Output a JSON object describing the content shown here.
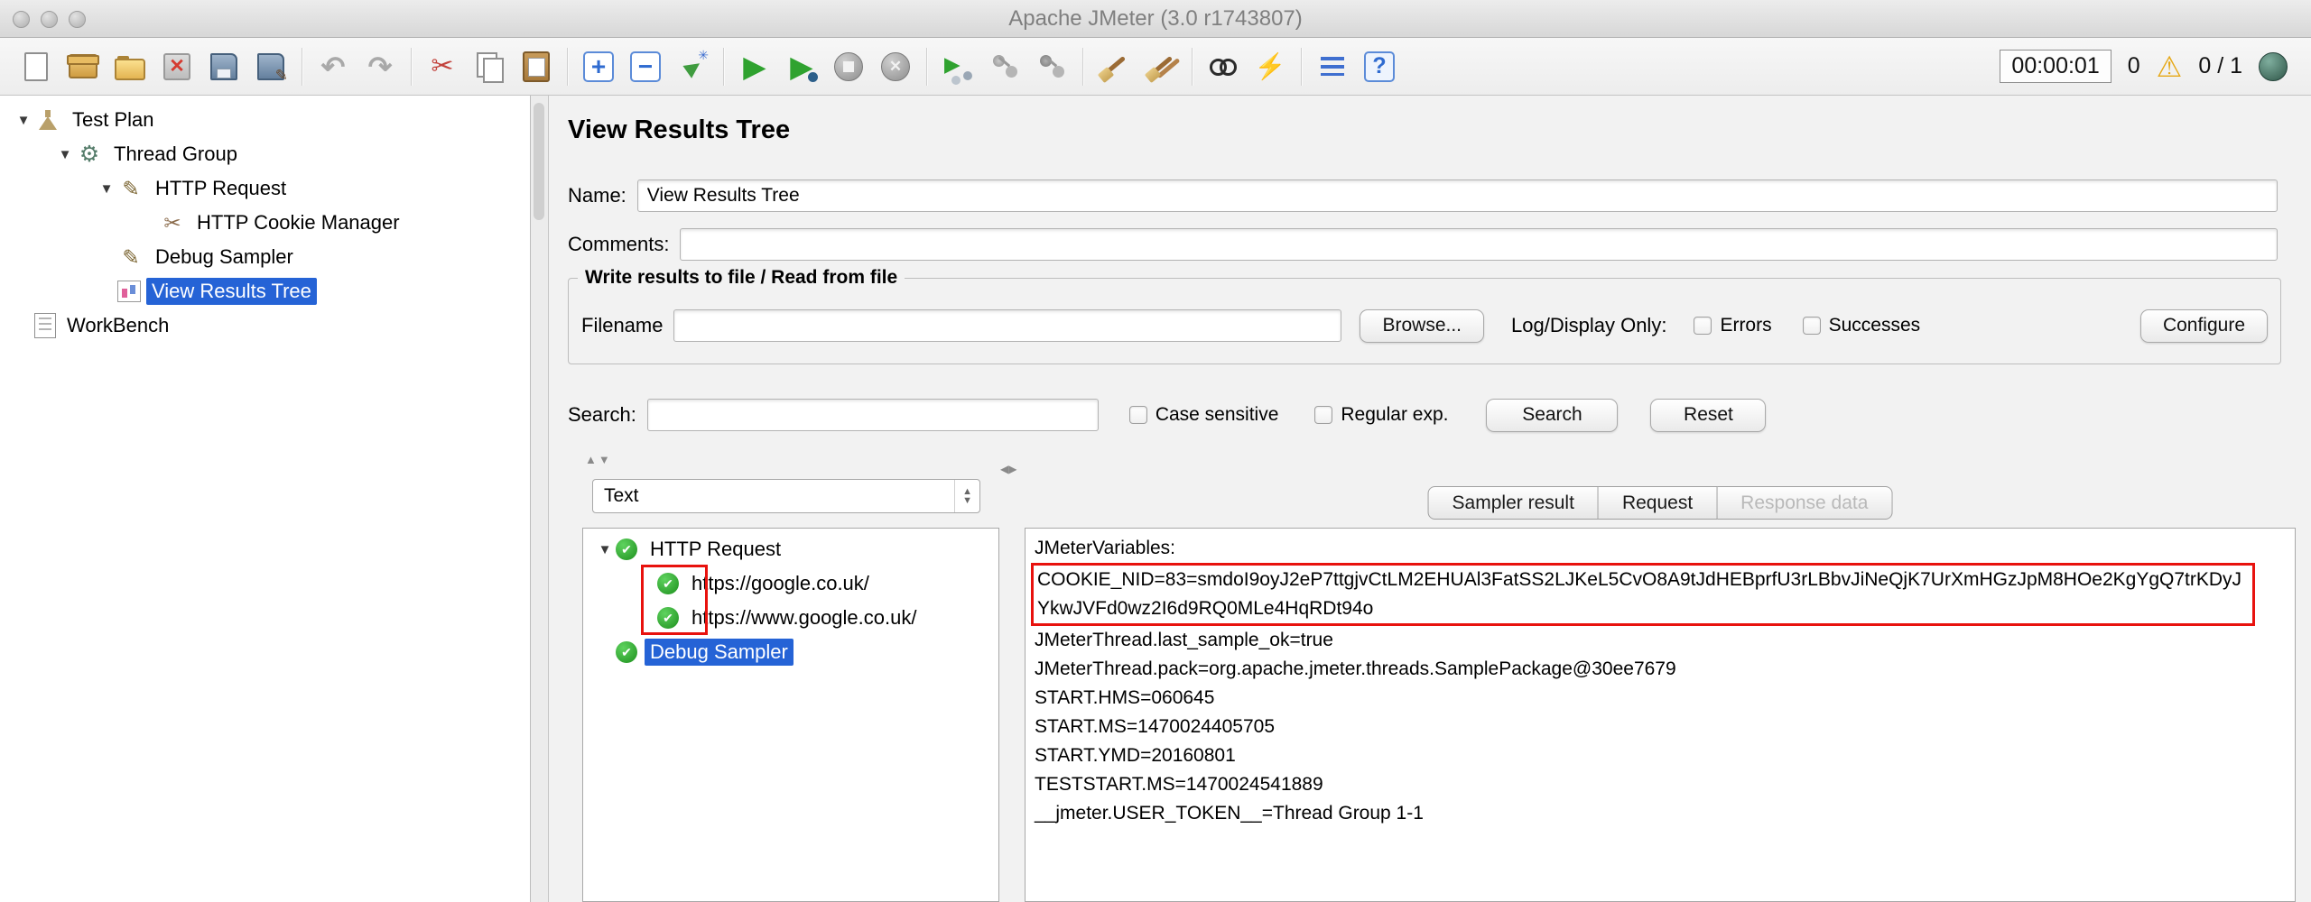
{
  "window": {
    "title": "Apache JMeter (3.0 r1743807)"
  },
  "toolbar": {
    "groups": [
      [
        "new-file-icon",
        "templates-icon",
        "open-folder-icon",
        "close-file-icon",
        "save-icon",
        "save-as-icon"
      ],
      [
        "undo-icon",
        "redo-icon"
      ],
      [
        "cut-icon",
        "copy-icon",
        "paste-icon"
      ],
      [
        "expand-all-icon",
        "collapse-all-icon",
        "toggle-icon"
      ],
      [
        "start-icon",
        "start-no-pauses-icon",
        "stop-icon",
        "shutdown-icon"
      ],
      [
        "remote-start-all-icon",
        "remote-stop-all-icon",
        "remote-shutdown-all-icon"
      ],
      [
        "clear-icon",
        "clear-all-icon"
      ],
      [
        "search-icon",
        "search-reset-icon"
      ],
      [
        "function-helper-icon",
        "help-icon"
      ]
    ],
    "timer": "00:00:01",
    "errors_count": "0",
    "threads": "0 / 1"
  },
  "sidebar": {
    "items": [
      {
        "label": "Test Plan",
        "level": 0,
        "expanded": true,
        "icon": "test-plan-icon"
      },
      {
        "label": "Thread Group",
        "level": 1,
        "expanded": true,
        "icon": "thread-group-icon"
      },
      {
        "label": "HTTP Request",
        "level": 2,
        "expanded": true,
        "icon": "http-request-icon"
      },
      {
        "label": "HTTP Cookie Manager",
        "level": 3,
        "icon": "cookie-manager-icon"
      },
      {
        "label": "Debug Sampler",
        "level": 2,
        "icon": "debug-sampler-icon"
      },
      {
        "label": "View Results Tree",
        "level": 2,
        "icon": "view-results-tree-icon",
        "selected": true
      },
      {
        "label": "WorkBench",
        "level": 0,
        "icon": "workbench-icon"
      }
    ]
  },
  "main": {
    "title": "View Results Tree",
    "name_label": "Name:",
    "name_value": "View Results Tree",
    "comments_label": "Comments:",
    "comments_value": "",
    "file_group": {
      "title": "Write results to file / Read from file",
      "filename_label": "Filename",
      "filename_value": "",
      "browse_button": "Browse...",
      "log_display_label": "Log/Display Only:",
      "errors_label": "Errors",
      "successes_label": "Successes",
      "configure_button": "Configure"
    },
    "search_bar": {
      "label": "Search:",
      "value": "",
      "case_sensitive_label": "Case sensitive",
      "regular_exp_label": "Regular exp.",
      "search_button": "Search",
      "reset_button": "Reset"
    },
    "results": {
      "view_selector": "Text",
      "tree": [
        {
          "label": "HTTP Request",
          "level": 0,
          "expanded": true,
          "status": "success"
        },
        {
          "label": "https://google.co.uk/",
          "level": 1,
          "status": "success"
        },
        {
          "label": "https://www.google.co.uk/",
          "level": 1,
          "status": "success"
        },
        {
          "label": "Debug Sampler",
          "level": 0,
          "status": "success",
          "selected": true
        }
      ],
      "tabs": [
        {
          "label": "Sampler result",
          "disabled": false
        },
        {
          "label": "Request",
          "disabled": false
        },
        {
          "label": "Response data",
          "disabled": true
        }
      ],
      "response": {
        "header_line": "JMeterVariables:",
        "highlighted_line": "COOKIE_NID=83=smdoI9oyJ2eP7ttgjvCtLM2EHUAl3FatSS2LJKeL5CvO8A9tJdHEBprfU3rLBbvJiNeQjK7UrXmHGzJpM8HOe2KgYgQ7trKDyJYkwJVFd0wz2I6d9RQ0MLe4HqRDt94o",
        "lines": [
          "JMeterThread.last_sample_ok=true",
          "JMeterThread.pack=org.apache.jmeter.threads.SamplePackage@30ee7679",
          "START.HMS=060645",
          "START.MS=1470024405705",
          "START.YMD=20160801",
          "TESTSTART.MS=1470024541889",
          "__jmeter.USER_TOKEN__=Thread Group 1-1"
        ]
      }
    }
  },
  "colors": {
    "selection_blue": "#2563d6",
    "annotation_red": "#e8120e",
    "success_green": "#1d8f1d",
    "warning_yellow": "#e6a817"
  }
}
